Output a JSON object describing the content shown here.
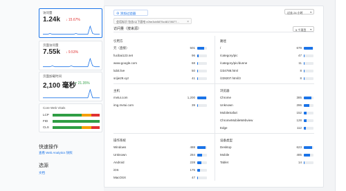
{
  "colors": {
    "accent": "#1a73e8",
    "good": "#2f9e44",
    "needs_improvement": "#f59f00",
    "poor": "#e03131"
  },
  "metrics": [
    {
      "title": "访问量",
      "value": "1.24k",
      "delta": "15.67%",
      "trend": "down",
      "active": true,
      "spark": [
        2,
        2,
        2,
        3,
        2,
        2,
        2,
        2,
        2,
        2,
        2,
        2,
        2,
        2,
        3,
        2,
        2,
        2,
        2,
        2,
        12,
        3,
        2,
        2,
        2
      ]
    },
    {
      "title": "页面访问量",
      "value": "7.55k",
      "delta": "9.53%",
      "trend": "down",
      "active": false,
      "spark": [
        2,
        2,
        2,
        2,
        3,
        2,
        2,
        2,
        2,
        2,
        2,
        2,
        3,
        2,
        2,
        2,
        2,
        2,
        2,
        2,
        12,
        3,
        2,
        2,
        2
      ]
    },
    {
      "title": "页面加载时间",
      "value": "2,100 毫秒",
      "delta": "21.35%",
      "trend": "up",
      "active": false,
      "spark": [
        2,
        2,
        2,
        2,
        2,
        2,
        2,
        2,
        2,
        2,
        2,
        2,
        2,
        2,
        2,
        2,
        2,
        2,
        2,
        2,
        13,
        2,
        2,
        2,
        2
      ]
    }
  ],
  "cwv": {
    "title": "Core Web Vitals",
    "rows": [
      {
        "label": "LCP",
        "good": 0.62,
        "needs": 0.2,
        "poor": 0.18
      },
      {
        "label": "FID",
        "good": 1.0,
        "needs": 0,
        "poor": 0
      },
      {
        "label": "CLS",
        "good": 0.62,
        "needs": 0.2,
        "poor": 0.18
      }
    ]
  },
  "quick_actions": {
    "title": "快速操作",
    "link": "查看 Web Analytics 快照"
  },
  "sources_sec": {
    "title": "选源",
    "link": "文档"
  },
  "toolbar": {
    "add_filter": "添加过滤器",
    "range": "过去 24 小时",
    "filter_chip": "会话标识 包含/以下面哈 e2be3cb5875c48178077..."
  },
  "tabs": {
    "label": "访问量（按来源）",
    "top_select": "5 个项目"
  },
  "referrers": {
    "title": "引用方",
    "rows": [
      {
        "label": "元（直接）",
        "value": "501",
        "frac": 0.7
      },
      {
        "label": "fucibai123.net",
        "value": "96",
        "frac": 0.15
      },
      {
        "label": "www.google.com",
        "value": "68",
        "frac": 0.1
      },
      {
        "label": "lubit.live",
        "value": "50",
        "frac": 0.08
      },
      {
        "label": "srijie29.xyz",
        "value": "41",
        "frac": 0.06
      }
    ]
  },
  "paths": {
    "title": "路径",
    "rows": [
      {
        "label": "/",
        "value": "679",
        "frac": 0.9
      },
      {
        "label": "/category/pic",
        "value": "47",
        "frac": 0.07
      },
      {
        "label": "/category/pic/dunne",
        "value": "11",
        "frac": 0.02
      },
      {
        "label": "/234788.html",
        "value": "8",
        "frac": 0.01
      },
      {
        "label": "/228207.html/3",
        "value": "8",
        "frac": 0.01
      }
    ]
  },
  "hosts": {
    "title": "主机",
    "rows": [
      {
        "label": "mvtui.com",
        "value": "1,200",
        "frac": 0.95
      },
      {
        "label": "img.mvtui.com",
        "value": "39",
        "frac": 0.03
      }
    ]
  },
  "browsers": {
    "title": "浏览器",
    "rows": [
      {
        "label": "Chrome",
        "value": "385",
        "frac": 0.75
      },
      {
        "label": "Unknown",
        "value": "286",
        "frac": 0.56
      },
      {
        "label": "MobileSafari",
        "value": "152",
        "frac": 0.3
      },
      {
        "label": "ChromeMobileWebview",
        "value": "128",
        "frac": 0.25
      },
      {
        "label": "Edge",
        "value": "112",
        "frac": 0.22
      }
    ]
  },
  "os": {
    "title": "操作系统",
    "rows": [
      {
        "label": "Windows",
        "value": "488",
        "frac": 0.85
      },
      {
        "label": "Unknown",
        "value": "284",
        "frac": 0.5
      },
      {
        "label": "Android",
        "value": "228",
        "frac": 0.4
      },
      {
        "label": "iOS",
        "value": "175",
        "frac": 0.3
      },
      {
        "label": "MacOSX",
        "value": "47",
        "frac": 0.08
      }
    ]
  },
  "devices": {
    "title": "设备类型",
    "rows": [
      {
        "label": "Desktop",
        "value": "623",
        "frac": 0.85
      },
      {
        "label": "Mobile",
        "value": "485",
        "frac": 0.66
      },
      {
        "label": "Tablet",
        "value": "14",
        "frac": 0.02
      }
    ]
  }
}
